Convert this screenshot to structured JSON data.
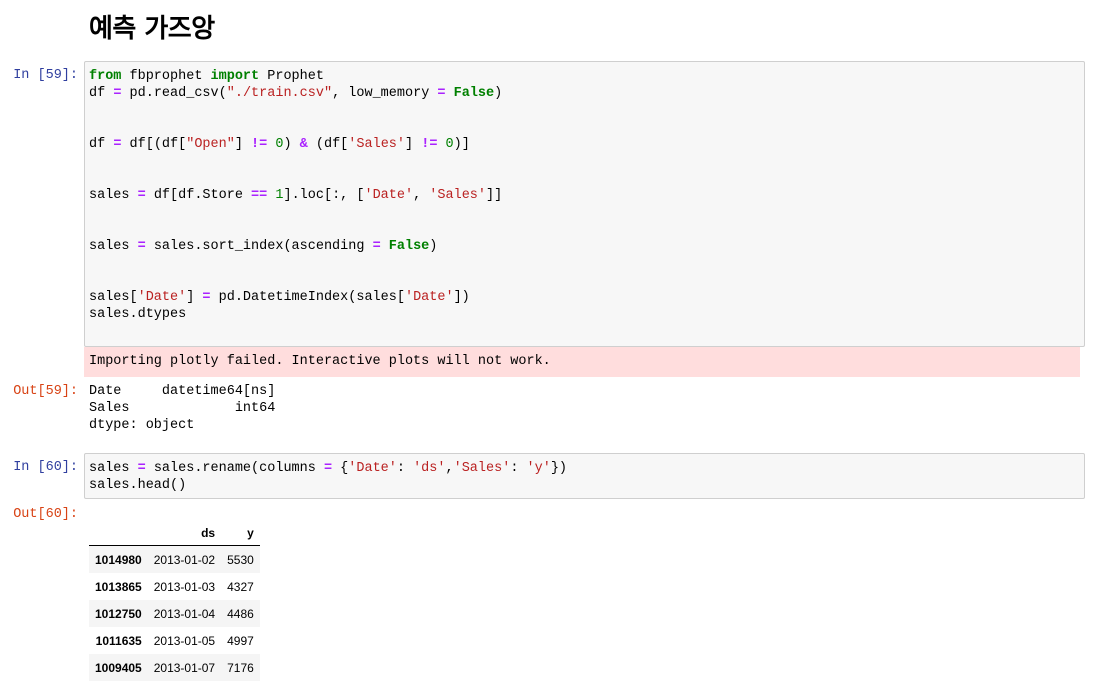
{
  "heading": "예측 가즈앙",
  "cells": [
    {
      "in_prompt": "In [59]:",
      "code_lines": [
        "from fbprophet import Prophet",
        "df = pd.read_csv(\"./train.csv\", low_memory = False)",
        "",
        "",
        "df = df[(df[\"Open\"] != 0) & (df['Sales'] != 0)]",
        "",
        "",
        "sales = df[df.Store == 1].loc[:, ['Date', 'Sales']]",
        "",
        "",
        "sales = sales.sort_index(ascending = False)",
        "",
        "",
        "sales['Date'] = pd.DatetimeIndex(sales['Date'])",
        "sales.dtypes"
      ],
      "stderr": "Importing plotly failed. Interactive plots will not work.",
      "out_prompt": "Out[59]:",
      "output_lines": [
        "Date     datetime64[ns]",
        "Sales             int64",
        "dtype: object"
      ]
    },
    {
      "in_prompt": "In [60]:",
      "code_lines": [
        "sales = sales.rename(columns = {'Date': 'ds','Sales': 'y'})",
        "sales.head()"
      ],
      "out_prompt": "Out[60]:",
      "table": {
        "columns": [
          "",
          "ds",
          "y"
        ],
        "rows": [
          [
            "1014980",
            "2013-01-02",
            "5530"
          ],
          [
            "1013865",
            "2013-01-03",
            "4327"
          ],
          [
            "1012750",
            "2013-01-04",
            "4486"
          ],
          [
            "1011635",
            "2013-01-05",
            "4997"
          ],
          [
            "1009405",
            "2013-01-07",
            "7176"
          ]
        ]
      }
    }
  ]
}
